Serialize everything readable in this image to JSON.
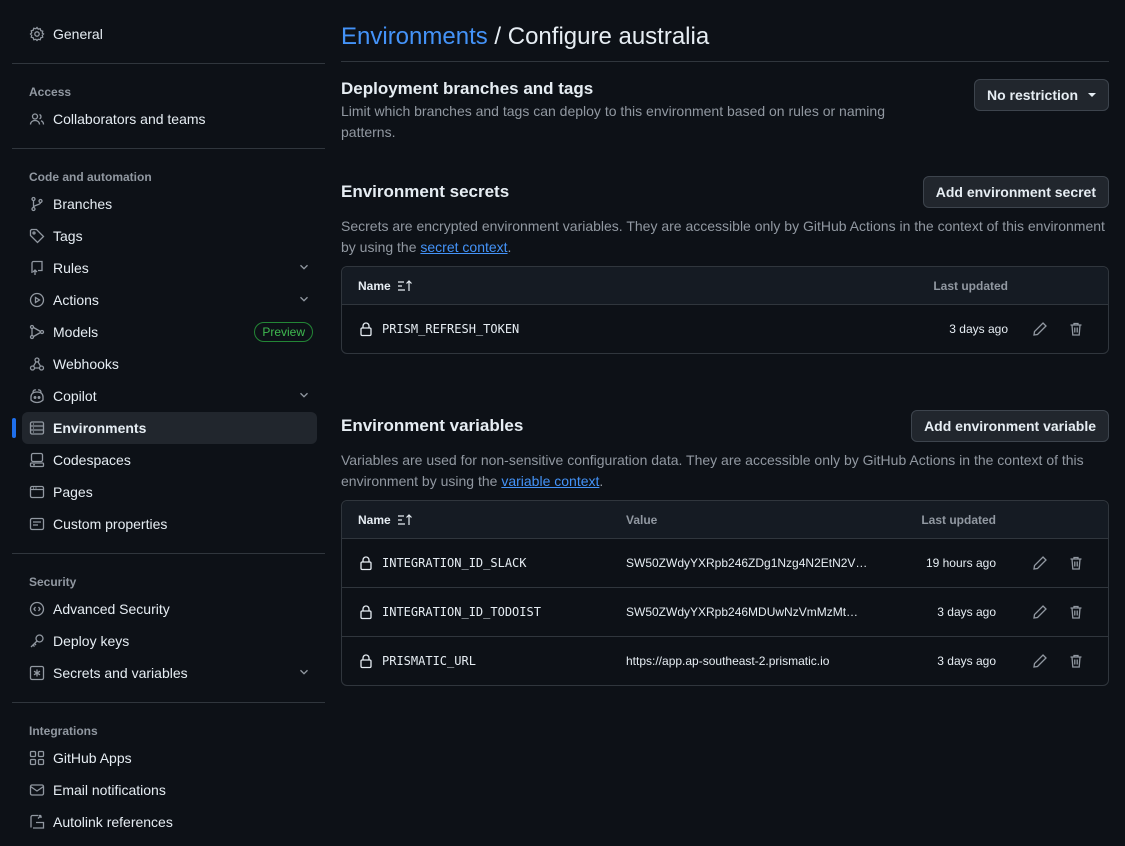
{
  "sidebar": {
    "general": "General",
    "groups": {
      "access": "Access",
      "code": "Code and automation",
      "security": "Security",
      "integrations": "Integrations"
    },
    "items": {
      "collaborators": "Collaborators and teams",
      "branches": "Branches",
      "tags": "Tags",
      "rules": "Rules",
      "actions": "Actions",
      "models": "Models",
      "models_badge": "Preview",
      "webhooks": "Webhooks",
      "copilot": "Copilot",
      "environments": "Environments",
      "codespaces": "Codespaces",
      "pages": "Pages",
      "custom_properties": "Custom properties",
      "advanced_security": "Advanced Security",
      "deploy_keys": "Deploy keys",
      "secrets_variables": "Secrets and variables",
      "github_apps": "GitHub Apps",
      "email_notifications": "Email notifications",
      "autolink": "Autolink references"
    }
  },
  "header": {
    "crumb": "Environments",
    "separator": " / ",
    "title": "Configure australia"
  },
  "deployment": {
    "title": "Deployment branches and tags",
    "desc": "Limit which branches and tags can deploy to this environment based on rules or naming patterns.",
    "dropdown": "No restriction"
  },
  "secrets": {
    "title": "Environment secrets",
    "button": "Add environment secret",
    "desc_prefix": "Secrets are encrypted environment variables. They are accessible only by GitHub Actions in the context of this environment by using the ",
    "desc_link": "secret context",
    "desc_suffix": ".",
    "col_name": "Name",
    "col_updated": "Last updated",
    "rows": [
      {
        "name": "PRISM_REFRESH_TOKEN",
        "updated": "3 days ago"
      }
    ]
  },
  "variables": {
    "title": "Environment variables",
    "button": "Add environment variable",
    "desc_prefix": "Variables are used for non-sensitive configuration data. They are accessible only by GitHub Actions in the context of this environment by using the ",
    "desc_link": "variable context",
    "desc_suffix": ".",
    "col_name": "Name",
    "col_value": "Value",
    "col_updated": "Last updated",
    "rows": [
      {
        "name": "INTEGRATION_ID_SLACK",
        "value": "SW50ZWdyYXRpb246ZDg1Nzg4N2EtN2V…",
        "updated": "19 hours ago"
      },
      {
        "name": "INTEGRATION_ID_TODOIST",
        "value": "SW50ZWdyYXRpb246MDUwNzVmMzMt…",
        "updated": "3 days ago"
      },
      {
        "name": "PRISMATIC_URL",
        "value": "https://app.ap-southeast-2.prismatic.io",
        "updated": "3 days ago"
      }
    ]
  },
  "colors": {
    "background": "#0d1117",
    "link": "#4493f8",
    "active_indicator": "#1f6feb",
    "preview_badge": "#3fb950"
  }
}
